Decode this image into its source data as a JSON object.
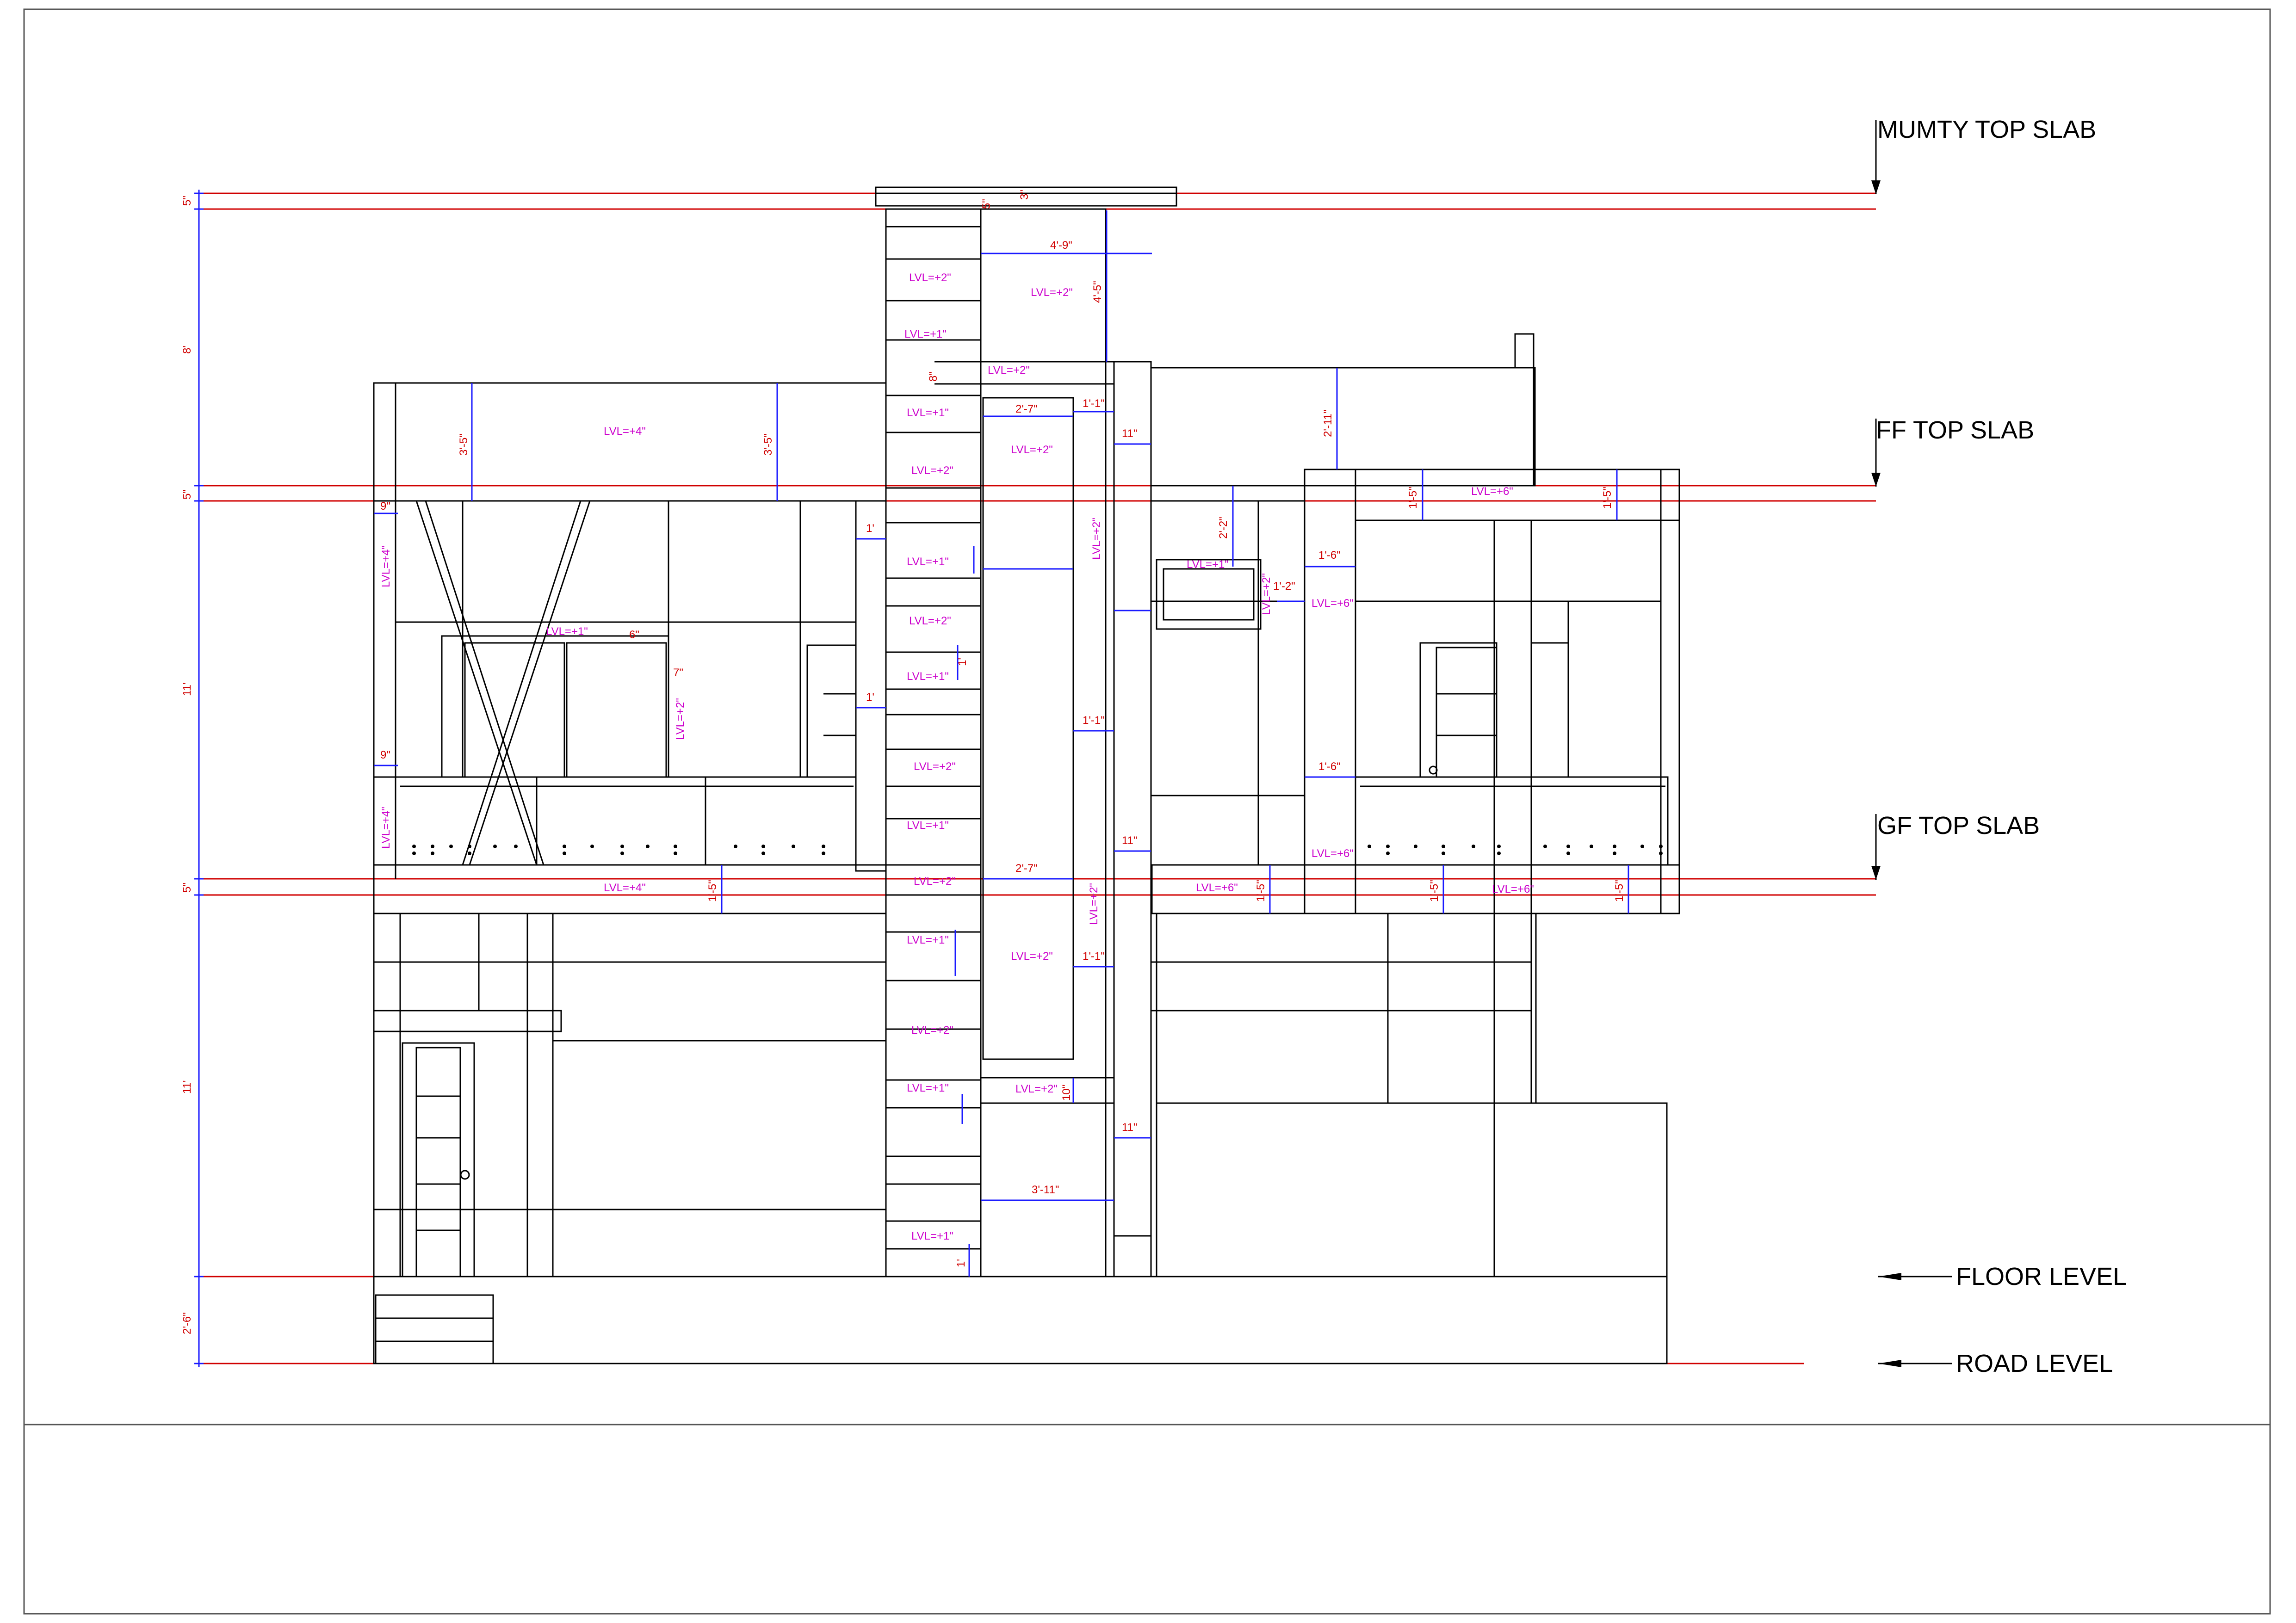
{
  "levels": {
    "mumty_top_slab": "MUMTY TOP SLAB",
    "ff_top_slab": "FF TOP SLAB",
    "gf_top_slab": "GF TOP SLAB",
    "floor_level": "FLOOR LEVEL",
    "road_level": "ROAD LEVEL"
  },
  "left_dimensions": [
    "5\"",
    "8'",
    "5\"",
    "11'",
    "5\"",
    "11'",
    "2'-6\""
  ],
  "dims": [
    "3\"",
    "5\"",
    "4'-9\"",
    "4'-5\"",
    "8\"",
    "1'-1\"",
    "11\"",
    "3'-5\"",
    "3'-5\"",
    "2'-7\"",
    "2'-11\"",
    "1'-5\"",
    "1'-5\"",
    "9\"",
    "1'",
    "2'-2\"",
    "1'-6\"",
    "1'-2\"",
    "6\"",
    "7\"",
    "1'",
    "1'-1\"",
    "9\"",
    "1'-6\"",
    "11\"",
    "2'-7\"",
    "1'-5\"",
    "1'-5\"",
    "1'-5\"",
    "1'-5\"",
    "1'-1\"",
    "10\"",
    "11\"",
    "3'-11\"",
    "1'",
    "1'"
  ],
  "lvl_labels": [
    "LVL=+2\"",
    "LVL=+2\"",
    "LVL=+1\"",
    "LVL=+2\"",
    "LVL=+4\"",
    "LVL=+2\"",
    "LVL=+1\"",
    "LVL=+2\"",
    "LVL=+6\"",
    "LVL=+4\"",
    "LVL=+1\"",
    "LVL=+1\"",
    "LVL=+1\"",
    "LVL=+2\"",
    "LVL=+2\"",
    "LVL=+6\"",
    "LVL=+2\"",
    "LVL=+1\"",
    "LVL=+2\"",
    "LVL=+4\"",
    "LVL=+1\"",
    "LVL=+6\"",
    "LVL=+4\"",
    "LVL=+2\"",
    "LVL=+2\"",
    "LVL=+6\"",
    "LVL=+6\"",
    "LVL=+1\"",
    "LVL=+2\"",
    "LVL=+2\"",
    "LVL=+2\"",
    "LVL=+1\"",
    "LVL=+2\"",
    "LVL=+1\""
  ],
  "colors": {
    "outline": "#000000",
    "dimension_line": "#d00000",
    "dimension_arrow": "#1a1aff",
    "lvl_label": "#cc00cc"
  }
}
